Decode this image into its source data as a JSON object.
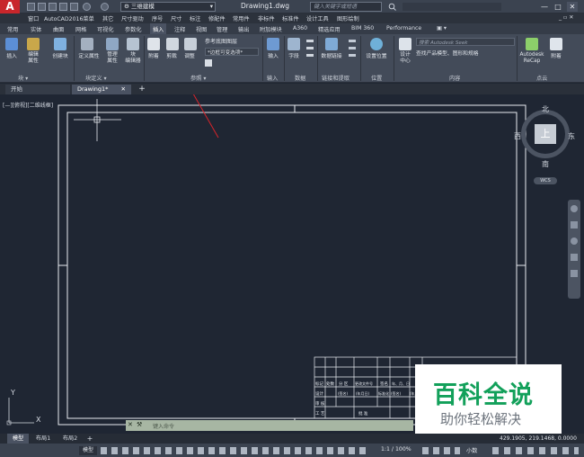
{
  "app": {
    "logo_letter": "A",
    "title": "Drawing1.dwg",
    "workspace": "三维建模",
    "search_placeholder": "键入关键字或短语",
    "window_controls": [
      "—",
      "□",
      "✕"
    ]
  },
  "menubar": {
    "items": [
      "窗口",
      "AutoCAD2016菜单",
      "其它",
      "尺寸驱动",
      "序号",
      "尺寸",
      "标注",
      "修配件",
      "常用件",
      "非标件",
      "标准件",
      "设计工具",
      "图形绘制"
    ],
    "right_controls": "_ ▫ ✕"
  },
  "ribbon_tabs": {
    "items": [
      "常用",
      "实体",
      "曲面",
      "网格",
      "可视化",
      "参数化",
      "插入",
      "注释",
      "视图",
      "管理",
      "输出",
      "附加模块",
      "A360",
      "精选应用",
      "BIM 360",
      "Performance"
    ],
    "active": "插入",
    "extra_icon": "▣ ▾"
  },
  "ribbon": {
    "block_panel": {
      "title": "块 ▾",
      "buttons": [
        "插入",
        "编辑\n属性",
        "创建块"
      ]
    },
    "block_def_panel": {
      "title": "块定义 ▾",
      "buttons": [
        "定义属性",
        "管理\n属性",
        "块\n编辑器"
      ]
    },
    "reference_panel": {
      "title": "参照 ▾",
      "buttons": [
        "附着",
        "剪裁",
        "调整"
      ],
      "list": [
        "参考底图图层",
        "*边框可变选项*"
      ]
    },
    "import_panel": {
      "title": "输入",
      "buttons": [
        "输入"
      ]
    },
    "data_panel": {
      "title": "数据",
      "buttons": [
        "字段"
      ]
    },
    "link_panel": {
      "title": "链接和提取",
      "buttons": [
        "数据链接"
      ]
    },
    "location_panel": {
      "title": "位置",
      "buttons": [
        "设置位置"
      ]
    },
    "content_panel": {
      "title": "内容",
      "buttons": [
        "设计\n中心"
      ],
      "search_placeholder": "搜索 Autodesk Seek",
      "search_text": "查找产品模型、图形和规格"
    },
    "pointcloud_panel": {
      "title": "点云",
      "buttons": [
        "Autodesk\nReCap",
        "附着"
      ]
    }
  },
  "filetabs": {
    "start": "开始",
    "drawing": "Drawing1*",
    "add": "+"
  },
  "canvas": {
    "viewport_label": "[—][俯视][二维线框]",
    "viewcube": {
      "north": "北",
      "south": "南",
      "east": "东",
      "west": "西",
      "face": "上",
      "wcs": "WCS"
    },
    "ucs": {
      "x": "X",
      "y": "Y"
    },
    "command_placeholder": "键入命令",
    "title_block_cells": [
      "标记",
      "处数",
      "分 区",
      "更改文件号",
      "签名",
      "年、月、日",
      "设计",
      "(签名)",
      "(年月日)",
      "标准化",
      "(签名)",
      "(年月日)",
      "审 核",
      "工 艺",
      "批 准"
    ]
  },
  "layout_tabs": [
    "模型",
    "布局1",
    "布局2",
    "+"
  ],
  "status": {
    "coordinates": "429.1905, 219.1468, 0.0000",
    "model": "模型",
    "scale": "1:1 / 100%",
    "units": "小数"
  },
  "watermark": {
    "title": "百科全说",
    "subtitle": "助你轻松解决"
  },
  "colors": {
    "accent_red": "#c8262b",
    "canvas_bg": "#1f2633",
    "ribbon_bg": "#434b59",
    "watermark_green": "#12a05a"
  }
}
